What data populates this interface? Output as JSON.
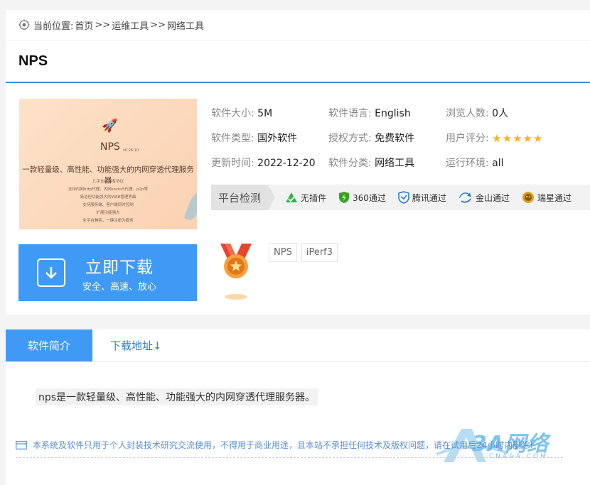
{
  "breadcrumb": {
    "prefix": "当前位置:",
    "home": "首页",
    "sep1": ">>",
    "category": "运维工具",
    "sep2": ">>",
    "subcategory": "网络工具"
  },
  "title": "NPS",
  "thumbnail": {
    "name": "NPS",
    "version": "v0.26.10",
    "headline": "一款轻量级、高性能、功能强大的内网穿透代理服务器",
    "lines": [
      "几乎支持所有协议",
      "支持内网http代理、内网socks5代理、p2p等",
      "简洁但功能强大的WEB管理界面",
      "支持服务端、客户端同时控制",
      "扩展功能强大",
      "全平台兼容，一键注册为服务"
    ]
  },
  "download_button": {
    "main": "立即下载",
    "sub": "安全、高速、放心"
  },
  "info": {
    "size_label": "软件大小:",
    "size_value": "5M",
    "lang_label": "软件语言:",
    "lang_value": "English",
    "views_label": "浏览人数:",
    "views_value": "0人",
    "type_label": "软件类型:",
    "type_value": "国外软件",
    "license_label": "授权方式:",
    "license_value": "免费软件",
    "rating_label": "用户评分:",
    "rating_value": 5,
    "update_label": "更新时间:",
    "update_value": "2022-12-20",
    "category_label": "软件分类:",
    "category_value": "网络工具",
    "env_label": "运行环境:",
    "env_value": "all"
  },
  "checks": {
    "label": "平台检测",
    "items": [
      {
        "name": "无插件",
        "icon": "no-plugin-icon",
        "color": "#2fb34a"
      },
      {
        "name": "360通过",
        "icon": "360-shield-icon",
        "color": "#2fa32f"
      },
      {
        "name": "腾讯通过",
        "icon": "tencent-shield-icon",
        "color": "#2b7fd4"
      },
      {
        "name": "金山通过",
        "icon": "kingsoft-icon",
        "color": "#2b7fd4"
      },
      {
        "name": "瑞星通过",
        "icon": "rising-lion-icon",
        "color": "#e0a21c"
      }
    ]
  },
  "tags": [
    "NPS",
    "iPerf3"
  ],
  "tabs": {
    "intro": "软件简介",
    "download": "下载地址↓"
  },
  "content": {
    "intro_text": "nps是一款轻量级、高性能、功能强大的内网穿透代理服务器。",
    "notice": "本系统及软件只用于个人封装技术研究交流使用，不得用于商业用途，且本站不承担任何技术及版权问题，请在试用后24小时内删除!"
  },
  "watermark": {
    "text": "3A网络",
    "sub": "CNAAA.COM"
  },
  "colors": {
    "accent": "#3f9af5",
    "star": "#f5b21c",
    "link": "#2b7fd4"
  }
}
